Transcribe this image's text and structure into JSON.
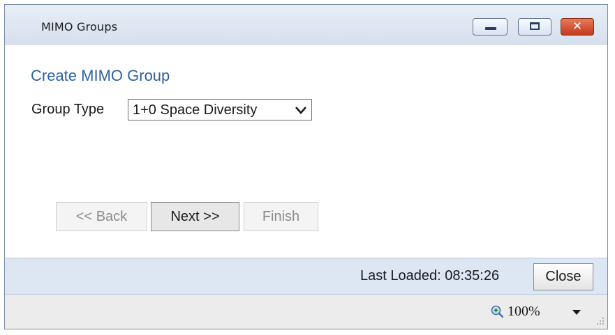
{
  "window": {
    "title": "MIMO Groups"
  },
  "form": {
    "heading": "Create MIMO Group",
    "group_type_label": "Group Type",
    "group_type_selected": "1+0 Space Diversity"
  },
  "wizard": {
    "back_label": "<< Back",
    "next_label": "Next >>",
    "finish_label": "Finish"
  },
  "status": {
    "last_loaded": "Last Loaded: 08:35:26",
    "close_label": "Close"
  },
  "zoom": {
    "level": "100%",
    "icon": "zoom-in-icon"
  },
  "colors": {
    "heading": "#2e62a3",
    "title_close_button": "#c23a1c",
    "status_bar": "#dde7f3"
  }
}
